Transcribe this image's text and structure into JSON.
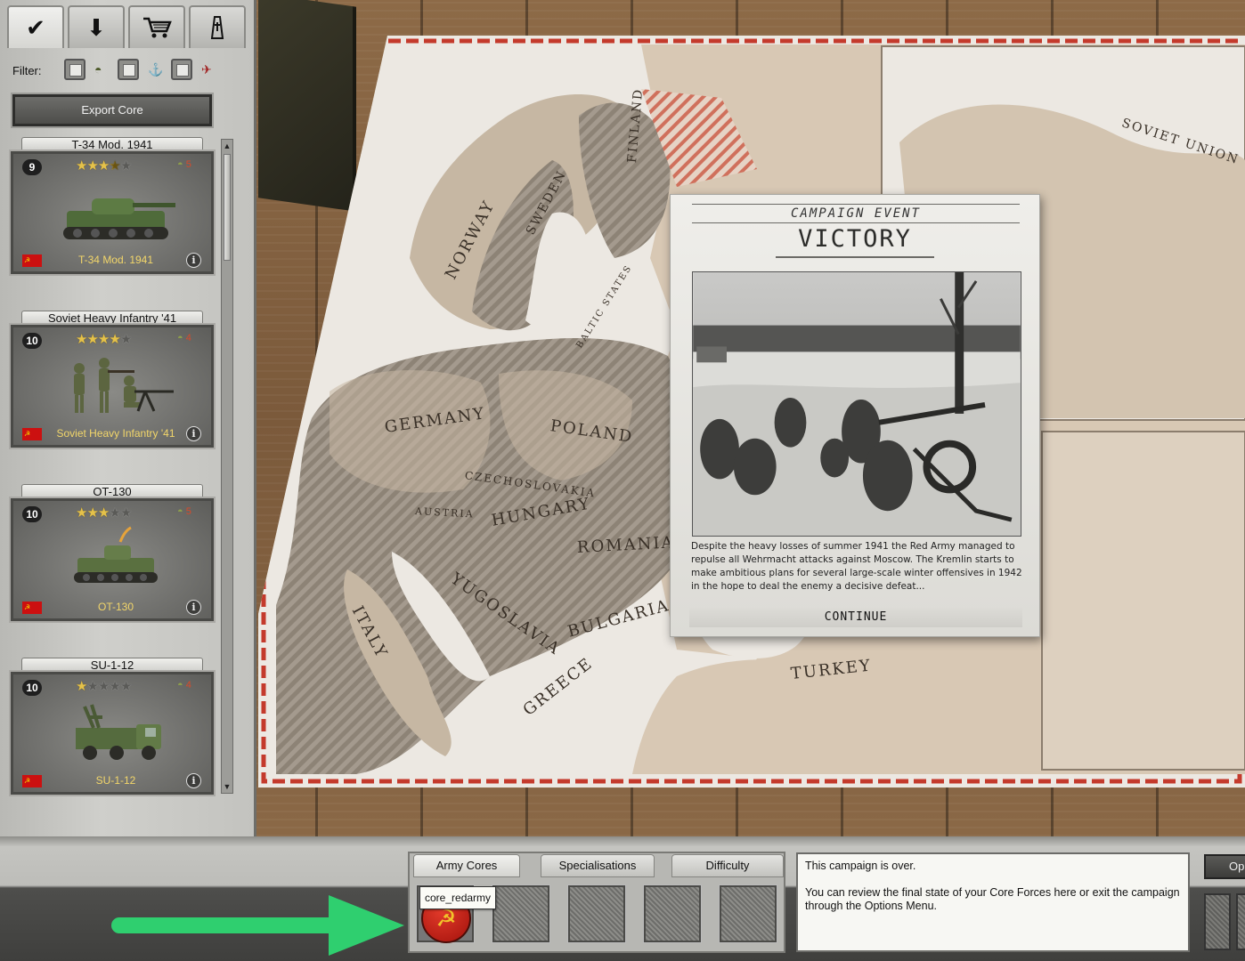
{
  "sidebar": {
    "tabs": [
      {
        "name": "checkmark-icon",
        "glyph": "✔"
      },
      {
        "name": "download-icon",
        "glyph": "⬇"
      },
      {
        "name": "shop-cart-icon",
        "glyph": "🛒"
      },
      {
        "name": "grave-icon",
        "glyph": "✝"
      }
    ],
    "filter_label": "Filter:",
    "filters": [
      "helmet-icon",
      "anchor-icon",
      "plane-icon"
    ],
    "export_label": "Export Core",
    "units": [
      {
        "title": "T-34 Mod. 1941",
        "name": "T-34 Mod. 1941",
        "level": "9",
        "stars": 3.5,
        "strength": "5",
        "pic": "tank"
      },
      {
        "title": "Soviet Heavy Infantry '41",
        "name": "Soviet Heavy Infantry '41",
        "level": "10",
        "stars": 4,
        "strength": "4",
        "pic": "infantry"
      },
      {
        "title": "OT-130",
        "name": "OT-130",
        "level": "10",
        "stars": 3,
        "strength": "5",
        "pic": "light-tank"
      },
      {
        "title": "SU-1-12",
        "name": "SU-1-12",
        "level": "10",
        "stars": 1,
        "strength": "4",
        "pic": "truck"
      }
    ],
    "info_glyph": "i",
    "flag_glyph": "☭"
  },
  "map": {
    "labels": {
      "norway": "NORWAY",
      "sweden": "SWEDEN",
      "finland": "FINLAND",
      "soviet_union": "SOVIET UNION",
      "baltic": "BALTIC STATES",
      "germany": "GERMANY",
      "poland": "POLAND",
      "czechoslovakia": "CZECHOSLOVAKIA",
      "austria": "AUSTRIA",
      "hungary": "HUNGARY",
      "romania": "ROMANIA",
      "yugoslavia": "YUGOSLAVIA",
      "italy": "ITALY",
      "bulgaria": "BULGARIA",
      "greece": "GREECE",
      "turkey": "TURKEY"
    }
  },
  "event": {
    "kicker": "CAMPAIGN EVENT",
    "title": "VICTORY",
    "text": "Despite the heavy losses of summer 1941 the Red Army managed to repulse all Wehrmacht attacks against Moscow. The Kremlin starts to make ambitious plans for several large-scale winter offensives in 1942 in the hope to deal the enemy a decisive defeat...",
    "continue_label": "CONTINUE"
  },
  "bottom": {
    "tabs": [
      "Army Cores",
      "Specialisations",
      "Difficulty"
    ],
    "active_tab": "Army Cores",
    "tooltip": "core_redarmy",
    "emblem_glyph": "☭",
    "info_line1": "This campaign is over.",
    "info_line2": "You can review the final state of your Core Forces here or exit the campaign through the Options Menu.",
    "options_label": "Op"
  },
  "colors": {
    "accent_gold": "#f2d66a",
    "soviet_red": "#cc1010",
    "arrow_green": "#2ecc71",
    "map_paper": "#d9cdbd"
  }
}
